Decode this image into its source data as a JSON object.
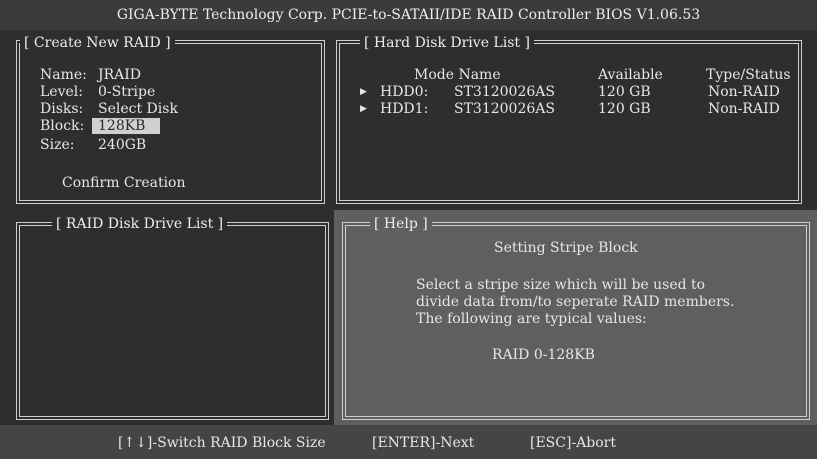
{
  "title": "GIGA-BYTE Technology Corp. PCIE-to-SATAII/IDE RAID Controller BIOS V1.06.53",
  "create_panel": {
    "title": "[ Create New RAID ]",
    "fields": [
      {
        "label": "Name:",
        "value": "JRAID"
      },
      {
        "label": "Level:",
        "value": "0-Stripe"
      },
      {
        "label": "Disks:",
        "value": "Select Disk"
      },
      {
        "label": "Block:",
        "value": "128KB"
      },
      {
        "label": "Size:",
        "value": "240GB"
      }
    ],
    "confirm_label": "Confirm Creation"
  },
  "hdd_panel": {
    "title": "[ Hard Disk Drive List ]",
    "headers": {
      "mode_name": "Mode Name",
      "available": "Available",
      "type_status": "Type/Status"
    },
    "rows": [
      {
        "mode": "HDD0:",
        "name": "ST3120026AS",
        "available": "120 GB",
        "status": "Non-RAID"
      },
      {
        "mode": "HDD1:",
        "name": "ST3120026AS",
        "available": "120 GB",
        "status": "Non-RAID"
      }
    ]
  },
  "raid_list_panel": {
    "title": "[ RAID Disk Drive List ]"
  },
  "help_panel": {
    "title": "[ Help ]",
    "heading": "Setting Stripe Block",
    "lines": [
      "Select a stripe size which will be used to",
      "divide data from/to seperate RAID members.",
      "The following are typical values:"
    ],
    "value": "RAID 0-128KB"
  },
  "footer": {
    "switch": "[↑↓]-Switch RAID Block Size",
    "next": "[ENTER]-Next",
    "abort": "[ESC]-Abort"
  }
}
